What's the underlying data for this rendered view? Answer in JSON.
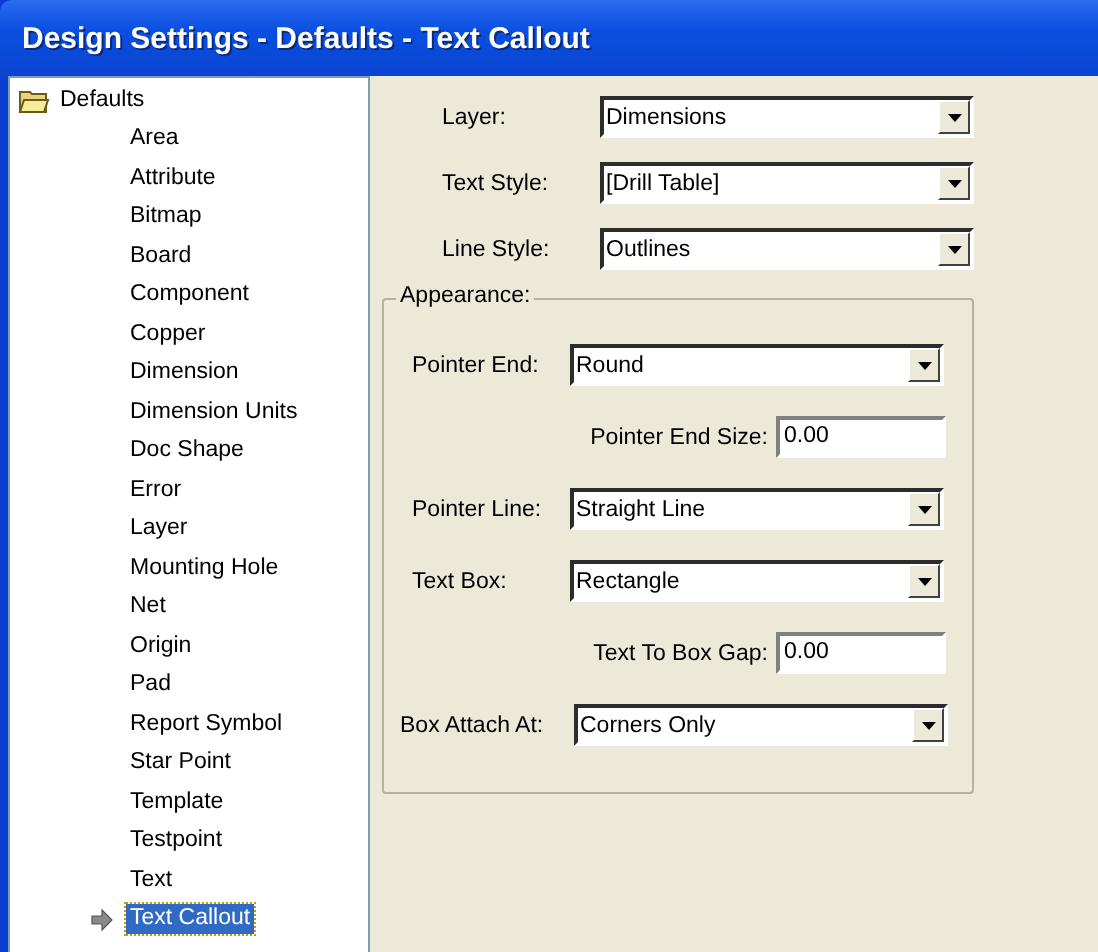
{
  "window": {
    "title": "Design Settings - Defaults - Text Callout"
  },
  "tree": {
    "label": "Defaults",
    "expanded": true,
    "children": [
      {
        "label": "Area",
        "selected": false
      },
      {
        "label": "Attribute",
        "selected": false
      },
      {
        "label": "Bitmap",
        "selected": false
      },
      {
        "label": "Board",
        "selected": false
      },
      {
        "label": "Component",
        "selected": false
      },
      {
        "label": "Copper",
        "selected": false
      },
      {
        "label": "Dimension",
        "selected": false
      },
      {
        "label": "Dimension Units",
        "selected": false
      },
      {
        "label": "Doc Shape",
        "selected": false
      },
      {
        "label": "Error",
        "selected": false
      },
      {
        "label": "Layer",
        "selected": false
      },
      {
        "label": "Mounting Hole",
        "selected": false
      },
      {
        "label": "Net",
        "selected": false
      },
      {
        "label": "Origin",
        "selected": false
      },
      {
        "label": "Pad",
        "selected": false
      },
      {
        "label": "Report Symbol",
        "selected": false
      },
      {
        "label": "Star Point",
        "selected": false
      },
      {
        "label": "Template",
        "selected": false
      },
      {
        "label": "Testpoint",
        "selected": false
      },
      {
        "label": "Text",
        "selected": false
      },
      {
        "label": "Text Callout",
        "selected": true
      }
    ]
  },
  "fields": [
    {
      "kind": "combo",
      "label": "Layer:",
      "value": "Dimensions"
    },
    {
      "kind": "combo",
      "label": "Text Style:",
      "value": "[Drill Table]"
    },
    {
      "kind": "combo",
      "label": "Line Style:",
      "value": "Outlines"
    }
  ],
  "appearance": {
    "title": "Appearance:",
    "fields": [
      {
        "kind": "combo",
        "label": "Pointer End:",
        "value": "Round"
      },
      {
        "kind": "text",
        "label": "Pointer End Size:",
        "value": "0.00"
      },
      {
        "kind": "combo",
        "label": "Pointer Line:",
        "value": "Straight Line"
      },
      {
        "kind": "combo",
        "label": "Text Box:",
        "value": "Rectangle"
      },
      {
        "kind": "text",
        "label": "Text To Box Gap:",
        "value": "0.00"
      },
      {
        "kind": "combo",
        "label": "Box Attach At:",
        "value": "Corners Only"
      }
    ]
  }
}
